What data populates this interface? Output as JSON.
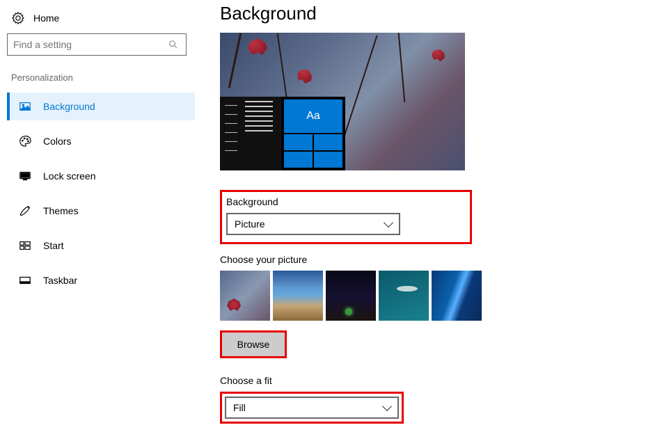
{
  "sidebar": {
    "home_label": "Home",
    "search_placeholder": "Find a setting",
    "section_header": "Personalization",
    "items": [
      {
        "label": "Background",
        "icon": "image-icon",
        "active": true
      },
      {
        "label": "Colors",
        "icon": "palette-icon"
      },
      {
        "label": "Lock screen",
        "icon": "monitor-icon"
      },
      {
        "label": "Themes",
        "icon": "brush-icon"
      },
      {
        "label": "Start",
        "icon": "start-grid-icon"
      },
      {
        "label": "Taskbar",
        "icon": "taskbar-icon"
      }
    ]
  },
  "main": {
    "page_title": "Background",
    "preview": {
      "accent_sample": "Aa"
    },
    "background_section": {
      "label": "Background",
      "value": "Picture"
    },
    "choose_picture": {
      "label": "Choose your picture",
      "browse_label": "Browse"
    },
    "choose_fit": {
      "label": "Choose a fit",
      "value": "Fill"
    }
  }
}
